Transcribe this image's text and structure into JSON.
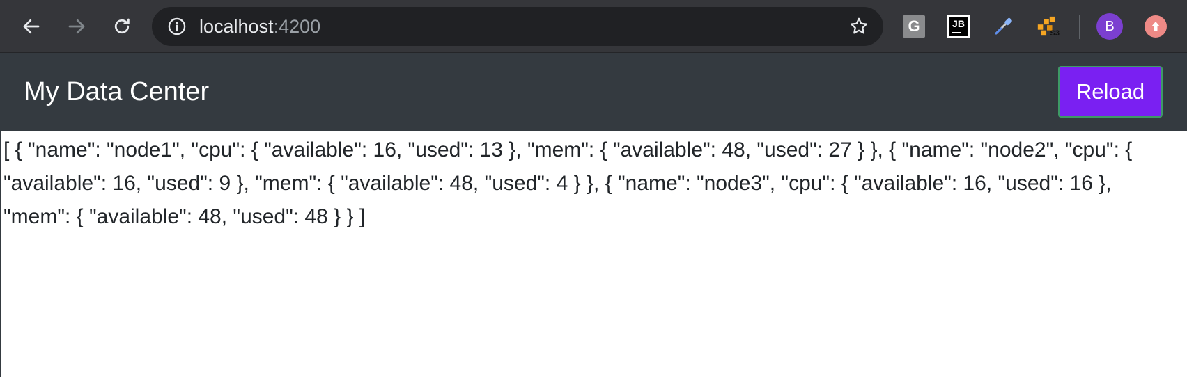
{
  "browser": {
    "url_host": "localhost",
    "url_port": ":4200",
    "extensions": [
      {
        "name": "g-extension-icon",
        "label": "G"
      },
      {
        "name": "jb-extension-icon",
        "label": "JB"
      },
      {
        "name": "color-dropper-icon"
      },
      {
        "name": "aws-s3-icon",
        "label": "S3"
      }
    ],
    "avatar_letter": "B",
    "icons": {
      "back": "arrow-left-icon",
      "forward": "arrow-right-icon",
      "reload": "reload-icon",
      "info": "info-icon",
      "bookmark": "star-icon",
      "update": "update-arrow-icon"
    },
    "colors": {
      "toolbar": "#35363a",
      "omnibox": "#202124",
      "avatar": "#7b3fd0",
      "update": "#ee8a86"
    }
  },
  "header": {
    "title": "My Data Center",
    "reload_label": "Reload",
    "colors": {
      "background": "#343a40",
      "button": "#7a20f2",
      "button_border": "#3e9a66"
    }
  },
  "main": {
    "json_text": "[ { \"name\": \"node1\", \"cpu\": { \"available\": 16, \"used\": 13 }, \"mem\": { \"available\": 48, \"used\": 27 } }, { \"name\": \"node2\", \"cpu\": { \"available\": 16, \"used\": 9 }, \"mem\": { \"available\": 48, \"used\": 4 } }, { \"name\": \"node3\", \"cpu\": { \"available\": 16, \"used\": 16 }, \"mem\": { \"available\": 48, \"used\": 48 } } ]"
  }
}
